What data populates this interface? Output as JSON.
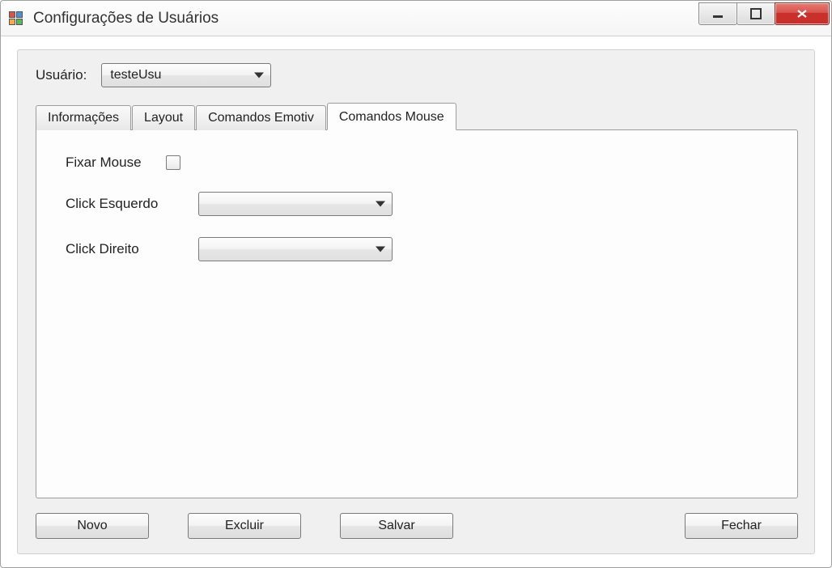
{
  "window": {
    "title": "Configurações de Usuários"
  },
  "user_row": {
    "label": "Usuário:",
    "selected": "testeUsu"
  },
  "tabs": [
    {
      "label": "Informações"
    },
    {
      "label": "Layout"
    },
    {
      "label": "Comandos Emotiv"
    },
    {
      "label": "Comandos Mouse"
    }
  ],
  "active_tab_index": 3,
  "mouse_tab": {
    "fixar_label": "Fixar Mouse",
    "fixar_checked": false,
    "click_left_label": "Click Esquerdo",
    "click_left_value": "",
    "click_right_label": "Click Direito",
    "click_right_value": ""
  },
  "buttons": {
    "novo": "Novo",
    "excluir": "Excluir",
    "salvar": "Salvar",
    "fechar": "Fechar"
  }
}
